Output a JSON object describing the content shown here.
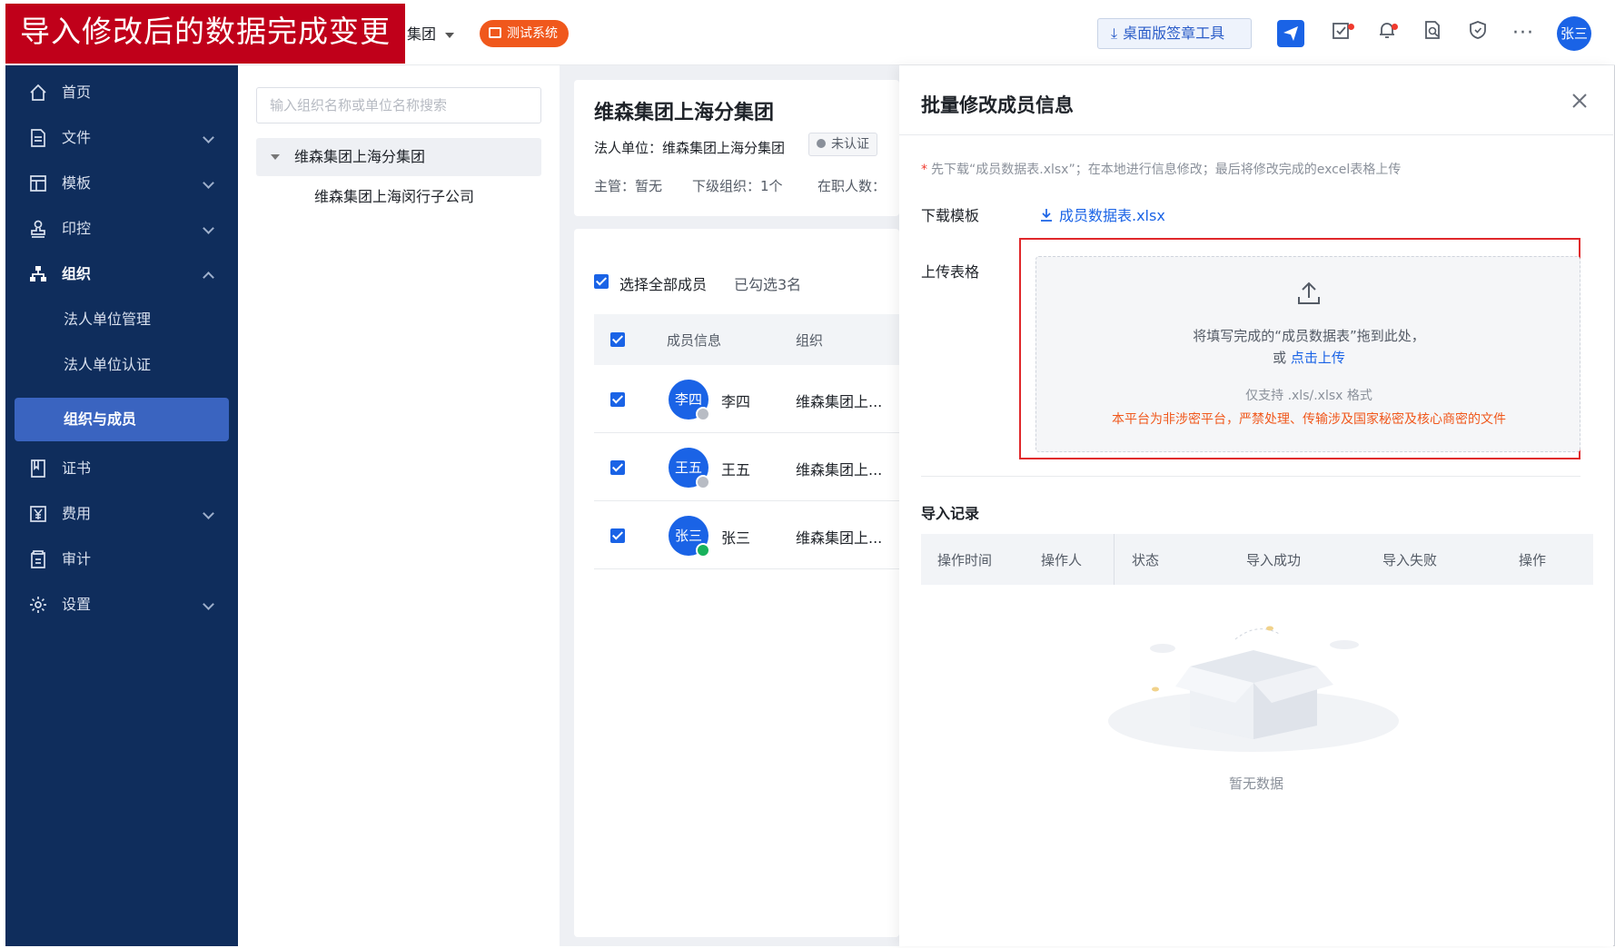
{
  "banner": {
    "text": "导入修改后的数据完成变更"
  },
  "header": {
    "org_name": "集团",
    "env_badge": "测试系统",
    "desk_tool": "桌面版签章工具",
    "avatar": "张三"
  },
  "sidebar": {
    "items": [
      {
        "label": "首页"
      },
      {
        "label": "文件"
      },
      {
        "label": "模板"
      },
      {
        "label": "印控"
      },
      {
        "label": "组织"
      },
      {
        "label": "证书"
      },
      {
        "label": "费用"
      },
      {
        "label": "审计"
      },
      {
        "label": "设置"
      }
    ],
    "sub_items": [
      {
        "label": "法人单位管理"
      },
      {
        "label": "法人单位认证"
      },
      {
        "label": "组织与成员"
      }
    ]
  },
  "tree": {
    "search_placeholder": "输入组织名称或单位名称搜索",
    "root": "维森集团上海分集团",
    "child": "维森集团上海闵行子公司"
  },
  "org": {
    "title": "维森集团上海分集团",
    "legal": "法人单位：维森集团上海分集团",
    "cert": "未认证",
    "supervisor": "主管：暂无",
    "sub_orgs": "下级组织：1个",
    "staff": "在职人数："
  },
  "members": {
    "select_all": "选择全部成员",
    "selected": "已勾选3名",
    "col_info": "成员信息",
    "col_org": "组织",
    "rows": [
      {
        "avatar": "李四",
        "name": "李四",
        "org": "维森集团上...",
        "status": "pending"
      },
      {
        "avatar": "王五",
        "name": "王五",
        "org": "维森集团上...",
        "status": "pending"
      },
      {
        "avatar": "张三",
        "name": "张三",
        "org": "维森集团上...",
        "status": "ok"
      }
    ]
  },
  "drawer": {
    "title": "批量修改成员信息",
    "tip_star": "*",
    "tip": "先下载“成员数据表.xlsx”；在本地进行信息修改；最后将修改完成的excel表格上传",
    "download_label": "下载模板",
    "download_link": "成员数据表.xlsx",
    "upload_label": "上传表格",
    "upload_line1": "将填写完成的“成员数据表”拖到此处，",
    "upload_or": "或",
    "upload_click": "点击上传",
    "upload_format": "仅支持 .xls/.xlsx 格式",
    "upload_warning": "本平台为非涉密平台，严禁处理、传输涉及国家秘密及核心商密的文件",
    "records_title": "导入记录",
    "records_cols": [
      "操作时间",
      "操作人",
      "状态",
      "导入成功",
      "导入失败",
      "操作"
    ],
    "empty": "暂无数据"
  }
}
